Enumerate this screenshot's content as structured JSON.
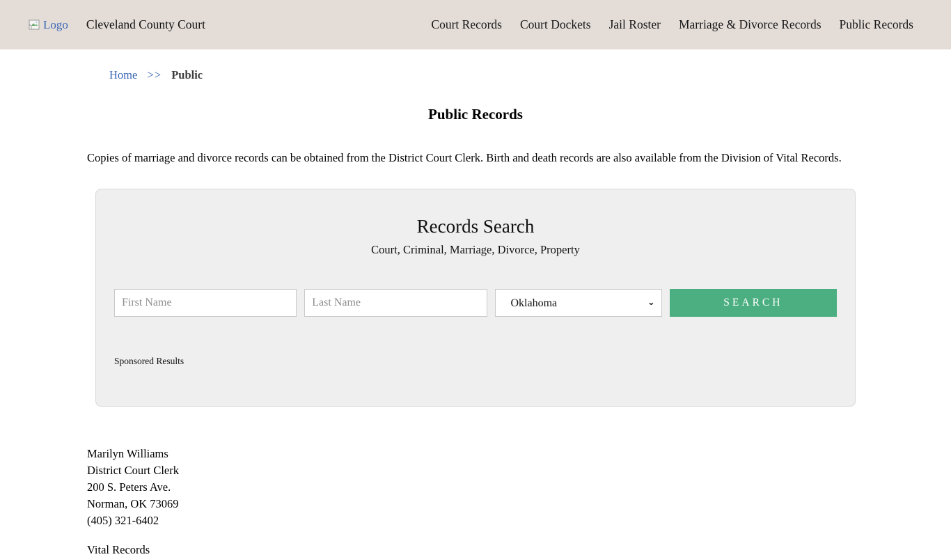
{
  "colors": {
    "header_bg": "#e3dcd7",
    "accent_green": "#4caf82",
    "link_blue": "#3a67b6",
    "panel_bg": "#efefef"
  },
  "header": {
    "logo_alt": "Logo",
    "site_title": "Cleveland County Court",
    "nav": [
      "Court Records",
      "Court Dockets",
      "Jail Roster",
      "Marriage & Divorce Records",
      "Public Records"
    ]
  },
  "breadcrumb": {
    "home": "Home",
    "separator": ">>",
    "current": "Public"
  },
  "page": {
    "title": "Public Records",
    "intro": "Copies of marriage and divorce records can be obtained from the District Court Clerk. Birth and death records are also available from the Division of Vital Records."
  },
  "search_panel": {
    "title": "Records Search",
    "subtitle": "Court, Criminal, Marriage, Divorce, Property",
    "first_name_placeholder": "First Name",
    "last_name_placeholder": "Last Name",
    "state_selected": "Oklahoma",
    "search_label": "SEARCH",
    "sponsored_label": "Sponsored Results"
  },
  "contact": {
    "name": "Marilyn Williams",
    "role": "District Court Clerk",
    "street": "200 S. Peters Ave.",
    "city_state_zip": "Norman, OK 73069",
    "phone": "(405) 321-6402"
  },
  "footer": {
    "vital_heading": "Vital Records"
  }
}
